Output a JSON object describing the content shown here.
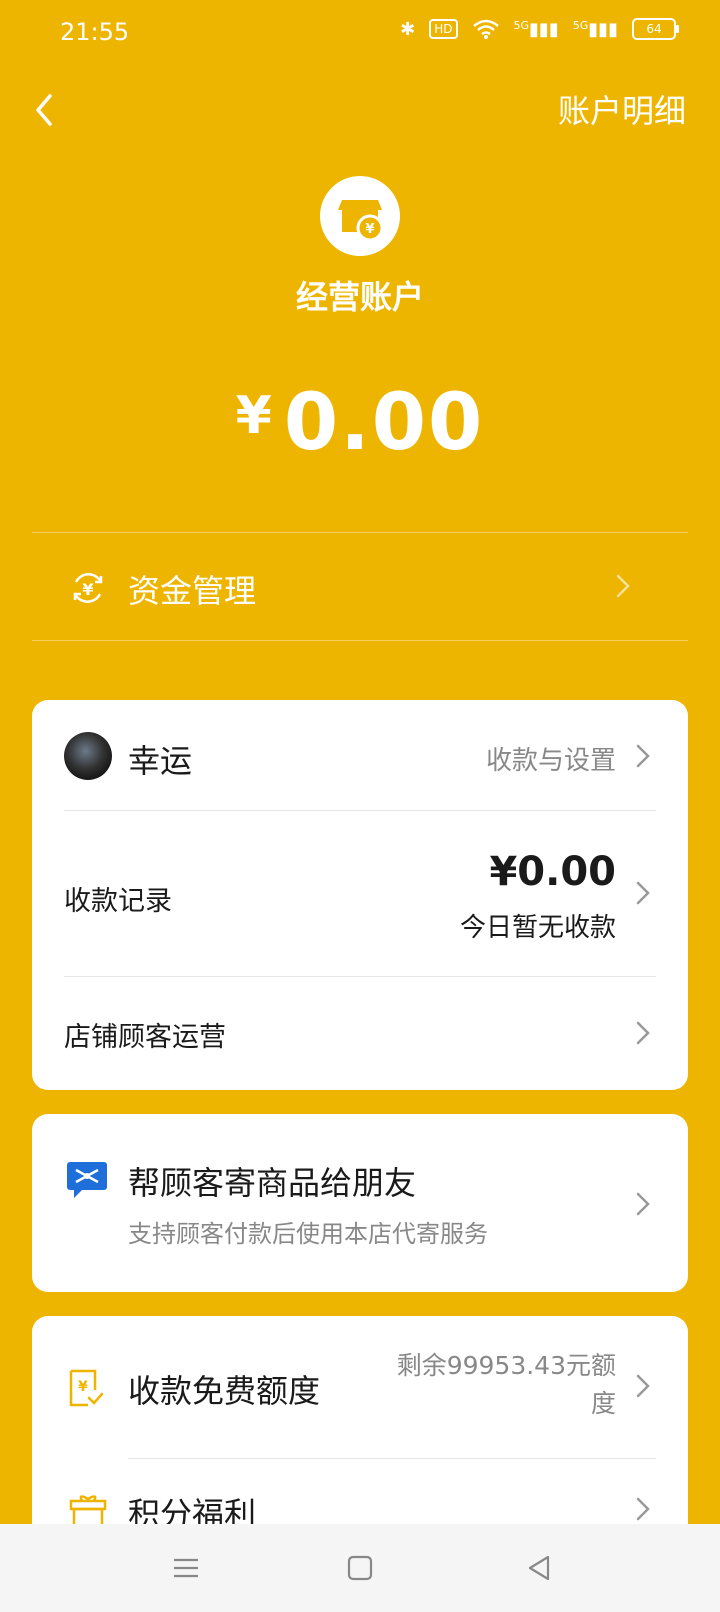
{
  "status_bar": {
    "time": "21:55",
    "hd": "HD",
    "net1": "5G",
    "net2": "5G",
    "battery": "64"
  },
  "header": {
    "detail_link": "账户明细"
  },
  "account": {
    "title": "经营账户",
    "currency": "¥",
    "balance": "0.00"
  },
  "fund_management": {
    "label": "资金管理"
  },
  "store_card": {
    "store_name": "幸运",
    "settings_link": "收款与设置",
    "records_label": "收款记录",
    "records_amount": "¥0.00",
    "records_note": "今日暂无收款",
    "customer_ops_label": "店铺顾客运营"
  },
  "gift_card": {
    "title": "帮顾客寄商品给朋友",
    "subtitle": "支持顾客付款后使用本店代寄服务"
  },
  "benefits_card": {
    "free_quota_label": "收款免费额度",
    "free_quota_value_line1": "剩余99953.43元额",
    "free_quota_value_line2": "度",
    "points_label": "积分福利"
  },
  "colors": {
    "brand_yellow": "#EEB500",
    "gift_blue": "#1E6FD9"
  },
  "icons": [
    "back-arrow-icon",
    "shop-yen-icon",
    "fund-cycle-icon",
    "chevron-right-icon",
    "gift-bubble-icon",
    "receipt-yen-icon",
    "gift-box-icon",
    "menu-icon",
    "home-icon",
    "nav-back-icon"
  ]
}
